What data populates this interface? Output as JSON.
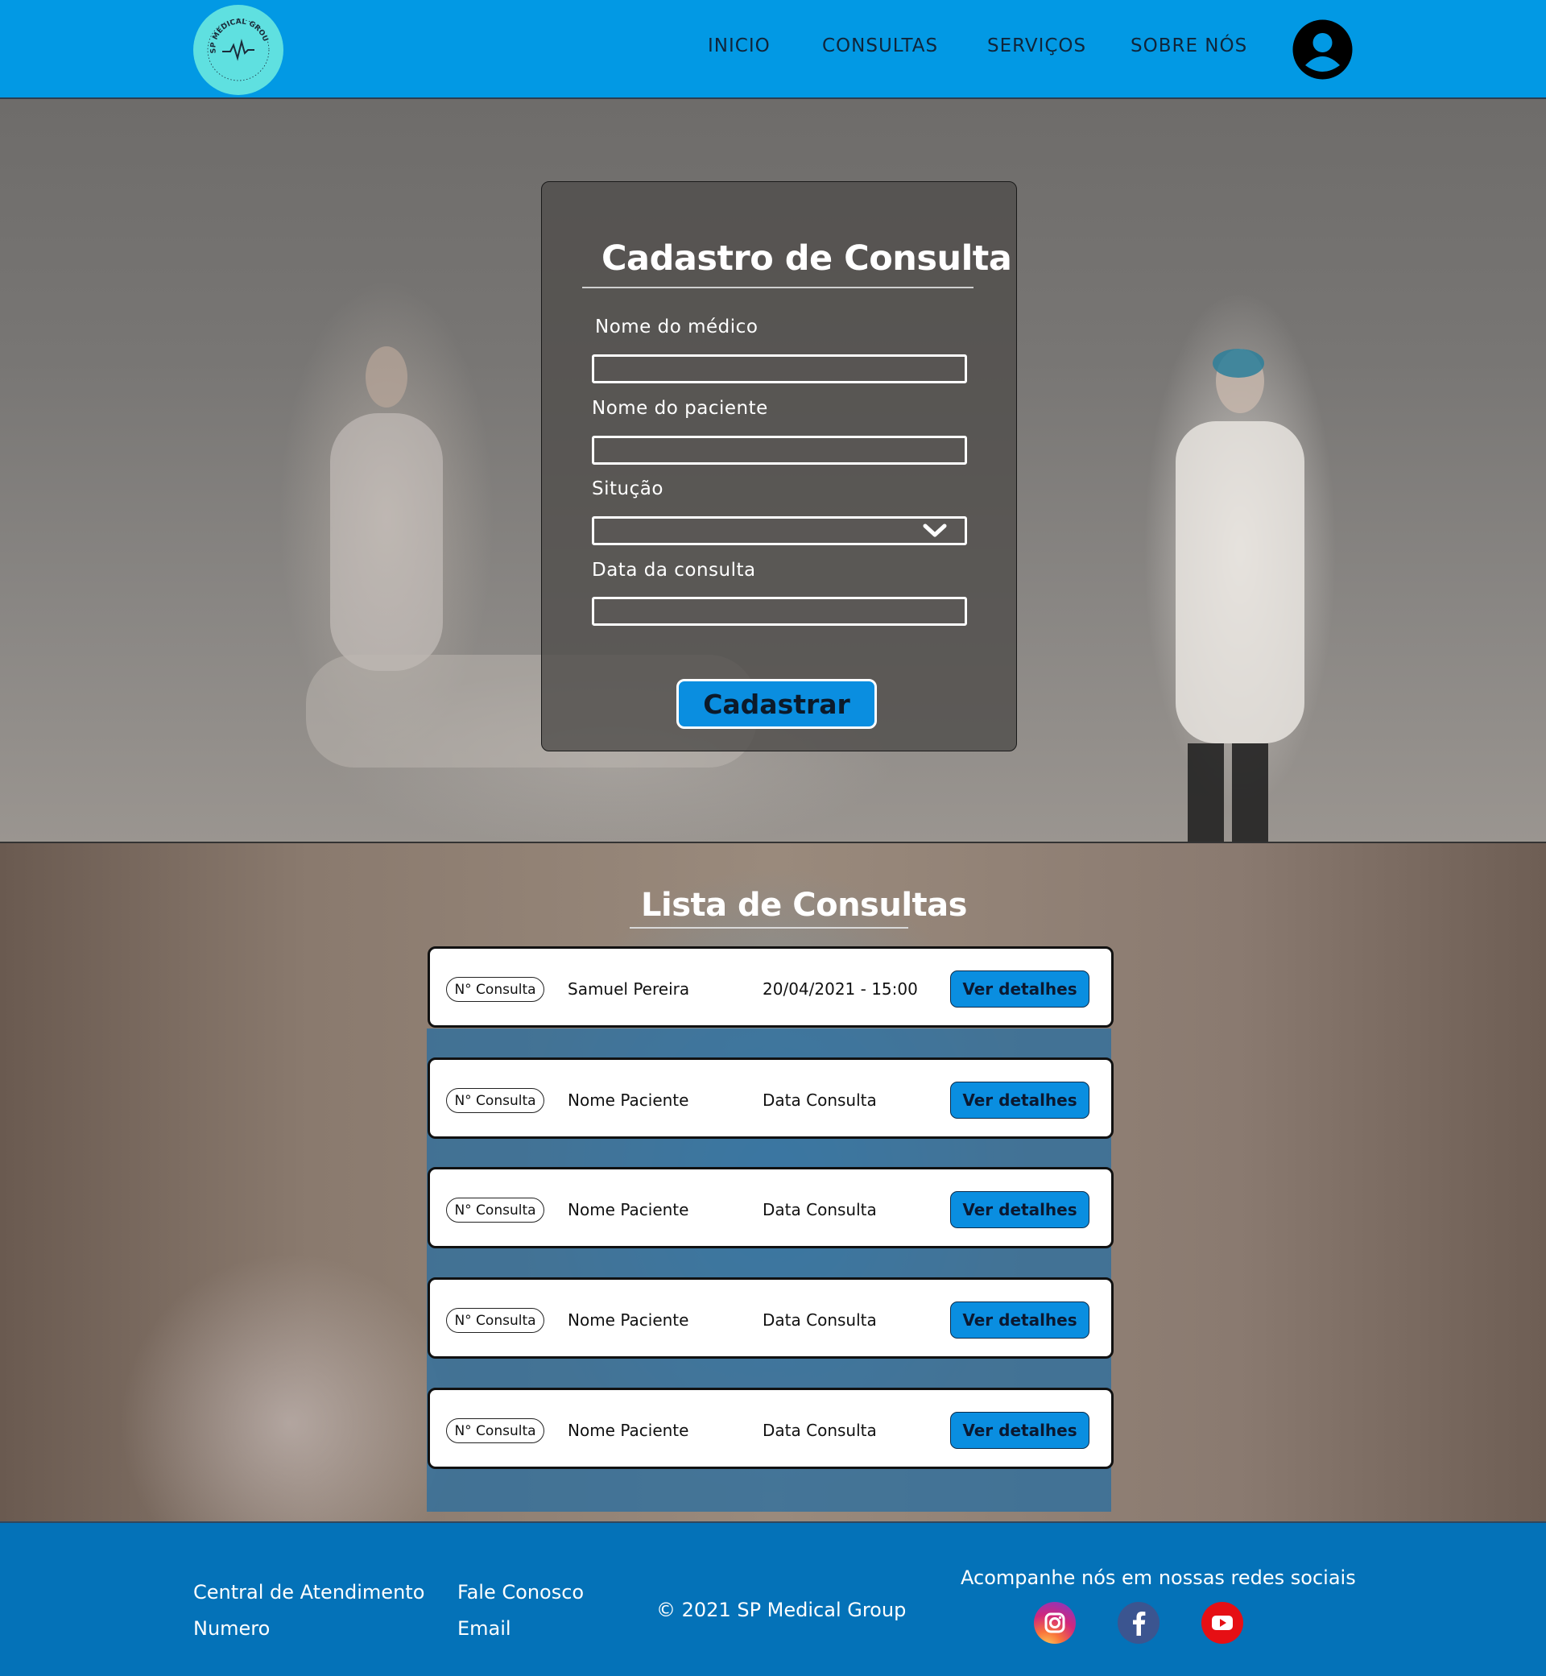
{
  "header": {
    "logo_text": "SP MEDICAL GROUP",
    "nav": [
      {
        "label": "INICIO"
      },
      {
        "label": "CONSULTAS"
      },
      {
        "label": "SERVIÇOS"
      },
      {
        "label": "SOBRE NÓS"
      }
    ],
    "user_icon": "user-account-icon"
  },
  "form": {
    "title": "Cadastro de Consulta",
    "fields": [
      {
        "label": "Nome do médico",
        "value": ""
      },
      {
        "label": "Nome do paciente",
        "value": ""
      },
      {
        "label": "Situção",
        "value": ""
      },
      {
        "label": "Data da consulta",
        "value": ""
      }
    ],
    "submit_label": "Cadastrar"
  },
  "list": {
    "title": "Lista de Consultas",
    "rows": [
      {
        "badge": "N° Consulta",
        "patient": "Samuel Pereira",
        "date": "20/04/2021 - 15:00",
        "action": "Ver detalhes"
      },
      {
        "badge": "N° Consulta",
        "patient": "Nome Paciente",
        "date": "Data Consulta",
        "action": "Ver detalhes"
      },
      {
        "badge": "N° Consulta",
        "patient": "Nome Paciente",
        "date": "Data Consulta",
        "action": "Ver detalhes"
      },
      {
        "badge": "N° Consulta",
        "patient": "Nome Paciente",
        "date": "Data Consulta",
        "action": "Ver detalhes"
      },
      {
        "badge": "N° Consulta",
        "patient": "Nome Paciente",
        "date": "Data Consulta",
        "action": "Ver detalhes"
      }
    ]
  },
  "footer": {
    "col1": [
      "Central de Atendimento",
      "Numero"
    ],
    "col2": [
      "Fale Conosco",
      "Email"
    ],
    "copyright": "© 2021 SP Medical Group",
    "social_heading": "Acompanhe nós em nossas redes sociais",
    "social": [
      "instagram-icon",
      "facebook-icon",
      "youtube-icon"
    ]
  },
  "colors": {
    "header_bg": "#0299e4",
    "accent_button": "#0a8ee0",
    "footer_bg": "#0472b8"
  }
}
